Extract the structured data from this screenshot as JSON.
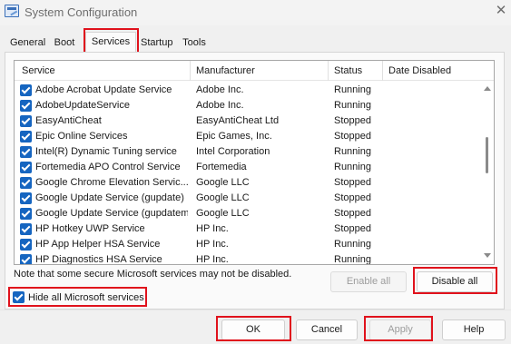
{
  "window": {
    "title": "System Configuration",
    "close_glyph": "✕",
    "icon": "msconfig-icon"
  },
  "tabs": [
    {
      "label": "General",
      "active": false
    },
    {
      "label": "Boot",
      "active": false
    },
    {
      "label": "Services",
      "active": true
    },
    {
      "label": "Startup",
      "active": false
    },
    {
      "label": "Tools",
      "active": false
    }
  ],
  "services": {
    "columns": [
      "Service",
      "Manufacturer",
      "Status",
      "Date Disabled"
    ],
    "rows": [
      {
        "checked": true,
        "service": "Adobe Acrobat Update Service",
        "manufacturer": "Adobe Inc.",
        "status": "Running",
        "date_disabled": ""
      },
      {
        "checked": true,
        "service": "AdobeUpdateService",
        "manufacturer": "Adobe Inc.",
        "status": "Running",
        "date_disabled": ""
      },
      {
        "checked": true,
        "service": "EasyAntiCheat",
        "manufacturer": "EasyAntiCheat Ltd",
        "status": "Stopped",
        "date_disabled": ""
      },
      {
        "checked": true,
        "service": "Epic Online Services",
        "manufacturer": "Epic Games, Inc.",
        "status": "Stopped",
        "date_disabled": ""
      },
      {
        "checked": true,
        "service": "Intel(R) Dynamic Tuning service",
        "manufacturer": "Intel Corporation",
        "status": "Running",
        "date_disabled": ""
      },
      {
        "checked": true,
        "service": "Fortemedia APO Control Service",
        "manufacturer": "Fortemedia",
        "status": "Running",
        "date_disabled": ""
      },
      {
        "checked": true,
        "service": "Google Chrome Elevation Servic...",
        "manufacturer": "Google LLC",
        "status": "Stopped",
        "date_disabled": ""
      },
      {
        "checked": true,
        "service": "Google Update Service (gupdate)",
        "manufacturer": "Google LLC",
        "status": "Stopped",
        "date_disabled": ""
      },
      {
        "checked": true,
        "service": "Google Update Service (gupdatem)",
        "manufacturer": "Google LLC",
        "status": "Stopped",
        "date_disabled": ""
      },
      {
        "checked": true,
        "service": "HP Hotkey UWP Service",
        "manufacturer": "HP Inc.",
        "status": "Stopped",
        "date_disabled": ""
      },
      {
        "checked": true,
        "service": "HP App Helper HSA Service",
        "manufacturer": "HP Inc.",
        "status": "Running",
        "date_disabled": ""
      },
      {
        "checked": true,
        "service": "HP Diagnostics HSA Service",
        "manufacturer": "HP Inc.",
        "status": "Running",
        "date_disabled": ""
      }
    ]
  },
  "note": "Note that some secure Microsoft services may not be disabled.",
  "buttons": {
    "enable_all": "Enable all",
    "disable_all": "Disable all",
    "ok": "OK",
    "cancel": "Cancel",
    "apply": "Apply",
    "help": "Help"
  },
  "hide_microsoft": {
    "checked": true,
    "label": "Hide all Microsoft services"
  },
  "colors": {
    "highlight": "#e0121c",
    "checkbox": "#1565c0"
  }
}
